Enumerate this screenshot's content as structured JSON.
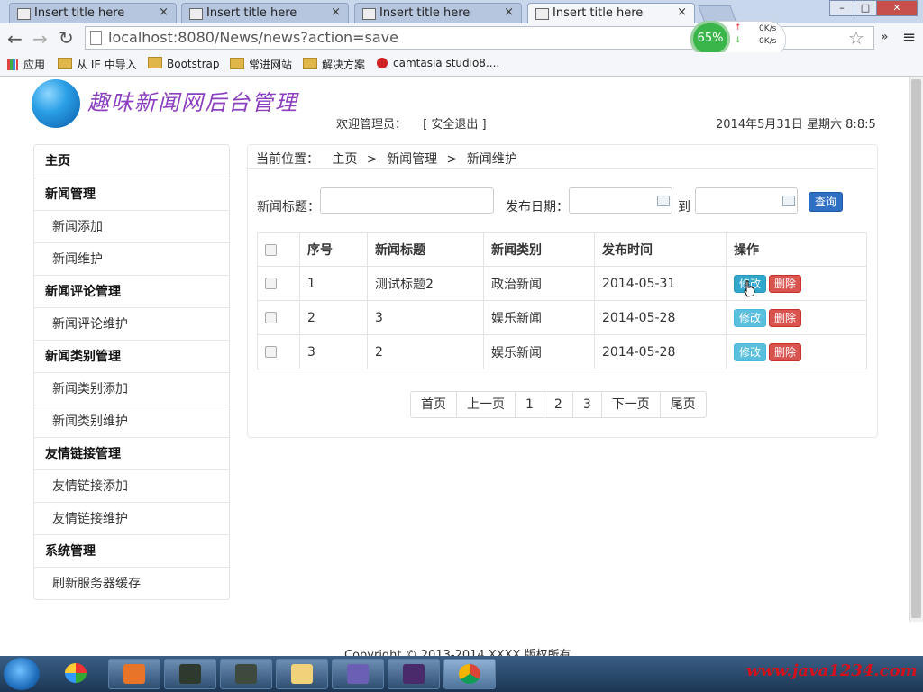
{
  "browser": {
    "tabs": [
      {
        "label": "Insert title here",
        "close": "×"
      },
      {
        "label": "Insert title here",
        "close": "×"
      },
      {
        "label": "Insert title here",
        "close": "×"
      },
      {
        "label": "Insert title here",
        "close": "×"
      }
    ],
    "url": "localhost:8080/News/news?action=save",
    "speed": {
      "percent": "65%",
      "up": "0K/s",
      "down": "0K/s"
    },
    "bookmarks": [
      "应用",
      "从 IE 中导入",
      "Bootstrap",
      "常进网站",
      "解决方案",
      "camtasia studio8...."
    ]
  },
  "header": {
    "title": "趣味新闻网后台管理",
    "welcome": "欢迎管理员：",
    "logout": "[ 安全退出 ]",
    "date": "2014年5月31日 星期六 8:8:5"
  },
  "sidebar": {
    "items": [
      {
        "label": "主页",
        "type": "head"
      },
      {
        "label": "新闻管理",
        "type": "head"
      },
      {
        "label": "新闻添加",
        "type": "sub"
      },
      {
        "label": "新闻维护",
        "type": "sub"
      },
      {
        "label": "新闻评论管理",
        "type": "head"
      },
      {
        "label": "新闻评论维护",
        "type": "sub"
      },
      {
        "label": "新闻类别管理",
        "type": "head"
      },
      {
        "label": "新闻类别添加",
        "type": "sub"
      },
      {
        "label": "新闻类别维护",
        "type": "sub"
      },
      {
        "label": "友情链接管理",
        "type": "head"
      },
      {
        "label": "友情链接添加",
        "type": "sub"
      },
      {
        "label": "友情链接维护",
        "type": "sub"
      },
      {
        "label": "系统管理",
        "type": "head"
      },
      {
        "label": "刷新服务器缓存",
        "type": "sub"
      }
    ]
  },
  "breadcrumb": {
    "prefix": "当前位置：",
    "home": "主页",
    "section": "新闻管理",
    "page": "新闻维护",
    "sep": ">"
  },
  "search": {
    "title_label": "新闻标题：",
    "date_label": "发布日期：",
    "to_label": "到",
    "query_button": "查询"
  },
  "table": {
    "headers": [
      "序号",
      "新闻标题",
      "新闻类别",
      "发布时间",
      "操作"
    ],
    "rows": [
      {
        "no": "1",
        "title": "测试标题2",
        "category": "政治新闻",
        "date": "2014-05-31"
      },
      {
        "no": "2",
        "title": "3",
        "category": "娱乐新闻",
        "date": "2014-05-28"
      },
      {
        "no": "3",
        "title": "2",
        "category": "娱乐新闻",
        "date": "2014-05-28"
      }
    ],
    "edit_label": "修改",
    "delete_label": "删除"
  },
  "pager": [
    "首页",
    "上一页",
    "1",
    "2",
    "3",
    "下一页",
    "尾页"
  ],
  "footer": "Copyright © 2013-2014 XXXX 版权所有",
  "watermark": "www.java1234.com"
}
